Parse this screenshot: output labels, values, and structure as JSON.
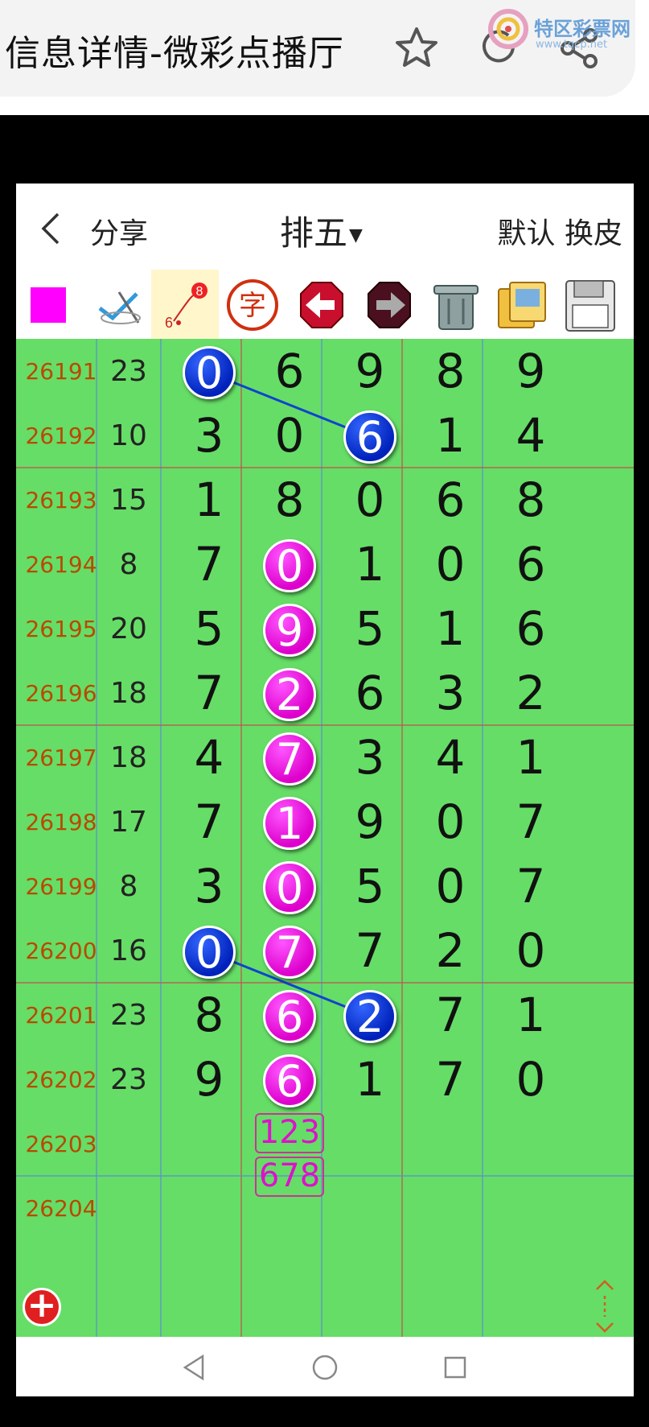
{
  "browser": {
    "title": "信息详情-微彩点播厅",
    "watermark_text": "特区彩票网",
    "watermark_url": "www.tqcp.net"
  },
  "app": {
    "back_icon": "chevron-left-icon",
    "share_label": "分享",
    "title": "排五",
    "skin_label": "默认 换皮"
  },
  "toolbar": {
    "icons": [
      "color-square-icon",
      "check-pen-icon",
      "sequence-icon",
      "character-icon",
      "arrow-left-icon",
      "arrow-right-icon",
      "trash-icon",
      "images-icon",
      "save-disk-icon"
    ],
    "sequence_labels": [
      "8",
      "6"
    ],
    "character_label": "字",
    "accent_color": "#ff00ff"
  },
  "grid": {
    "rows": [
      {
        "issue": "26191",
        "sum": "23",
        "digits": [
          "0",
          "6",
          "9",
          "8",
          "9"
        ]
      },
      {
        "issue": "26192",
        "sum": "10",
        "digits": [
          "3",
          "0",
          "6",
          "1",
          "4"
        ]
      },
      {
        "issue": "26193",
        "sum": "15",
        "digits": [
          "1",
          "8",
          "0",
          "6",
          "8"
        ]
      },
      {
        "issue": "26194",
        "sum": "8",
        "digits": [
          "7",
          "0",
          "1",
          "0",
          "6"
        ]
      },
      {
        "issue": "26195",
        "sum": "20",
        "digits": [
          "5",
          "9",
          "5",
          "1",
          "6"
        ]
      },
      {
        "issue": "26196",
        "sum": "18",
        "digits": [
          "7",
          "2",
          "6",
          "3",
          "2"
        ]
      },
      {
        "issue": "26197",
        "sum": "18",
        "digits": [
          "4",
          "7",
          "3",
          "4",
          "1"
        ]
      },
      {
        "issue": "26198",
        "sum": "17",
        "digits": [
          "7",
          "1",
          "9",
          "0",
          "7"
        ]
      },
      {
        "issue": "26199",
        "sum": "8",
        "digits": [
          "3",
          "0",
          "5",
          "0",
          "7"
        ]
      },
      {
        "issue": "26200",
        "sum": "16",
        "digits": [
          "0",
          "7",
          "7",
          "2",
          "0"
        ]
      },
      {
        "issue": "26201",
        "sum": "23",
        "digits": [
          "8",
          "6",
          "2",
          "7",
          "1"
        ]
      },
      {
        "issue": "26202",
        "sum": "23",
        "digits": [
          "9",
          "6",
          "1",
          "7",
          "0"
        ]
      },
      {
        "issue": "26203",
        "sum": "",
        "digits": [
          "",
          "",
          "",
          "",
          ""
        ]
      },
      {
        "issue": "26204",
        "sum": "",
        "digits": [
          "",
          "",
          "",
          "",
          ""
        ]
      }
    ],
    "blue_highlights": [
      [
        0,
        0
      ],
      [
        1,
        2
      ],
      [
        9,
        0
      ],
      [
        10,
        2
      ]
    ],
    "pink_highlights": [
      [
        3,
        1
      ],
      [
        4,
        1
      ],
      [
        5,
        1
      ],
      [
        6,
        1
      ],
      [
        7,
        1
      ],
      [
        8,
        1
      ],
      [
        9,
        1
      ],
      [
        10,
        1
      ],
      [
        11,
        1
      ]
    ],
    "prediction": [
      "123",
      "678"
    ],
    "colors": {
      "background": "#66dd66",
      "issue_text": "#b84a00",
      "blue_ball": "#0022bb",
      "pink_ball": "#dd00cc"
    }
  },
  "controls": {
    "add_icon": "plus-circle-icon",
    "scroll_icon": "scroll-arrows-icon"
  },
  "navbar": {
    "icons": [
      "nav-back-icon",
      "nav-home-icon",
      "nav-recent-icon"
    ]
  }
}
